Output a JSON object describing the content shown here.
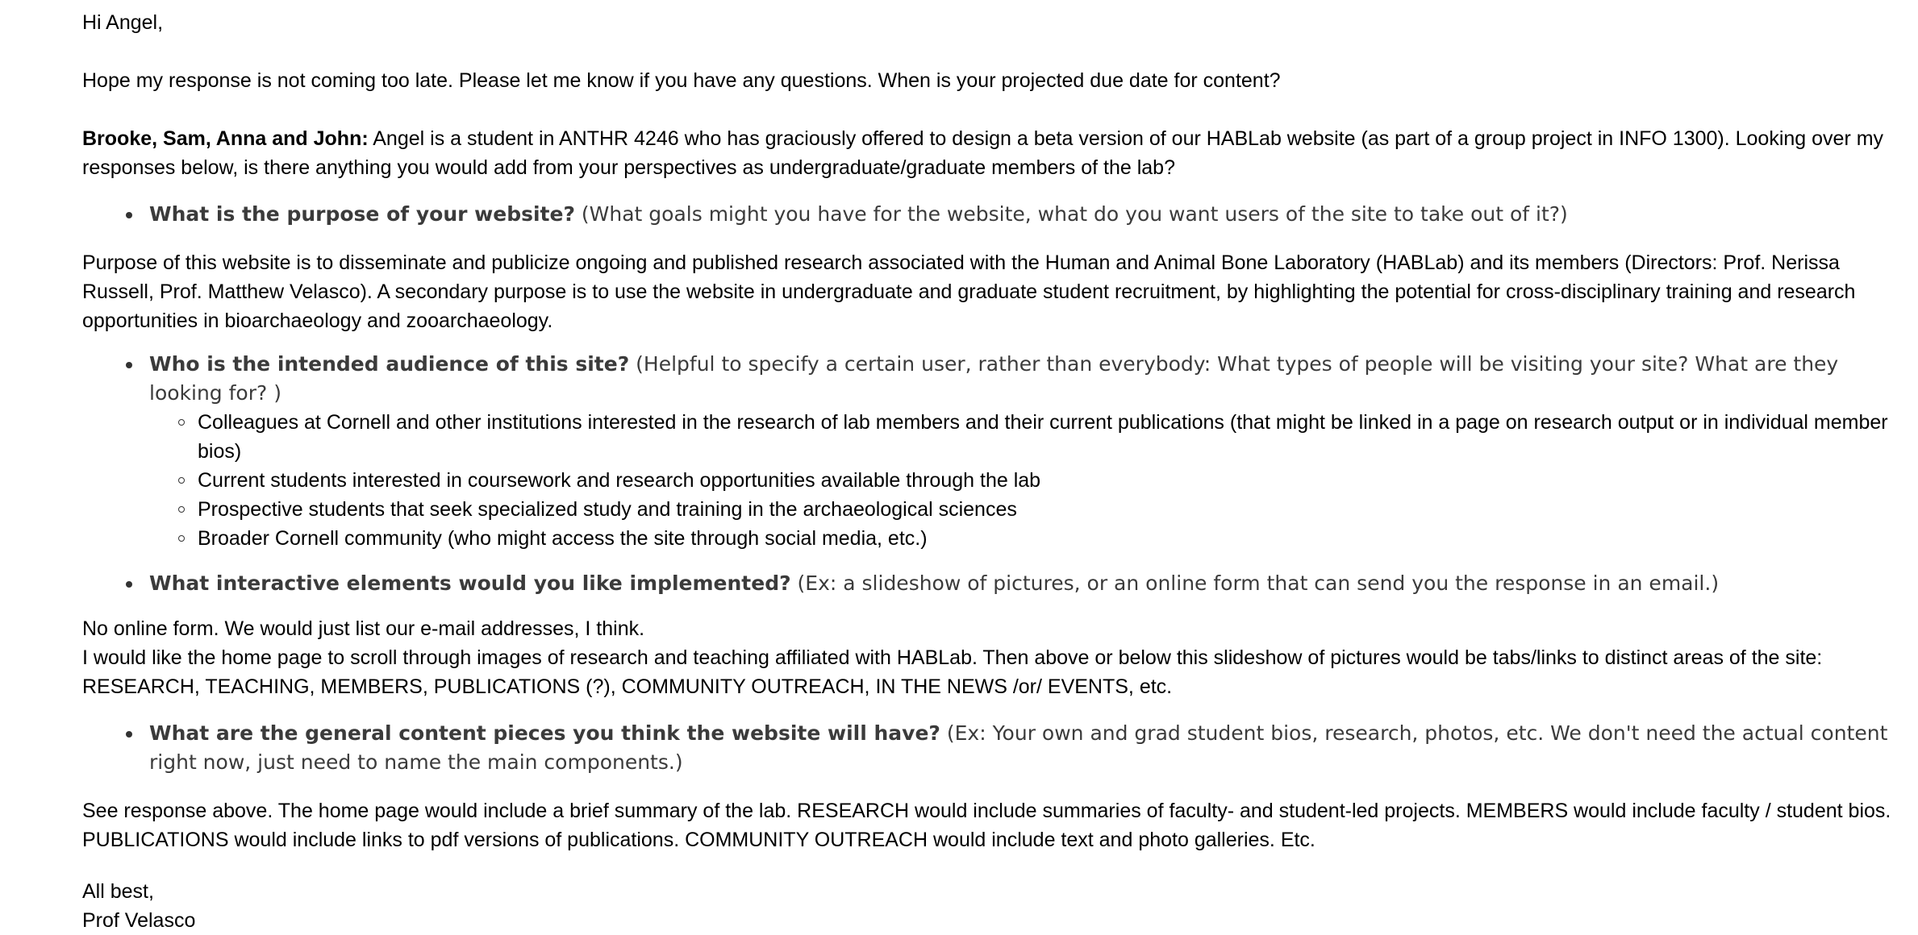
{
  "email": {
    "greeting": "Hi Angel,",
    "intro": "Hope my response is not coming too late. Please let me know if you have any questions. When is your projected due date for content?",
    "addressees": "Brooke, Sam, Anna and John:",
    "addressees_body": " Angel is a student in ANTHR 4246 who has graciously offered to design a beta version of our HABLab website (as part of a group project in INFO 1300). Looking over my responses below, is there anything you would add from your perspectives as undergraduate/graduate members of the lab?",
    "q1": {
      "question": "What is the purpose of your website?",
      "hint": " (What goals might you have for the website, what do you want users of the site to take out of it?)"
    },
    "a1": "Purpose of this website is to disseminate and publicize ongoing and published research associated with the Human and Animal Bone Laboratory (HABLab) and its members (Directors: Prof. Nerissa Russell, Prof. Matthew Velasco). A secondary purpose is to use the website in undergraduate and graduate student recruitment, by highlighting the potential for cross-disciplinary training and research opportunities in bioarchaeology and zooarchaeology.",
    "q2": {
      "question": "Who is the intended audience of this site?",
      "hint": " (Helpful to specify a certain user, rather than everybody: What types of people will be visiting your site? What are they looking for? )",
      "audiences": [
        "Colleagues at Cornell and other institutions interested in the research of lab members and their current publications (that might be linked in a page on research output or in individual member bios)",
        "Current students interested in coursework and research opportunities available through the lab",
        "Prospective students that seek specialized study and training in the archaeological sciences",
        "Broader Cornell community (who might access the site through social media, etc.)"
      ]
    },
    "q3": {
      "question": "What interactive elements would you like implemented?",
      "hint": " (Ex: a slideshow of pictures, or an online form that can send you the response in an email.)"
    },
    "a3_line1": "No online form. We would just list our e-mail addresses, I think.",
    "a3_line2": "I would like the home page to scroll through images of research and teaching affiliated with HABLab. Then above or below this slideshow of pictures would be tabs/links to distinct areas of the site: RESEARCH, TEACHING, MEMBERS, PUBLICATIONS (?), COMMUNITY OUTREACH, IN THE NEWS /or/ EVENTS, etc.",
    "q4": {
      "question": "What are the general content pieces you think the website will have?",
      "hint": " (Ex: Your own and grad student bios, research, photos, etc. We don't need the actual content right now, just need to name the main components.)"
    },
    "a4": "See response above. The home page would include a brief summary of the lab. RESEARCH would include summaries of faculty- and student-led projects. MEMBERS would include faculty / student bios. PUBLICATIONS would include links to pdf versions of publications. COMMUNITY OUTREACH would include text and photo galleries. Etc.",
    "signoff": "All best,",
    "signature": "Prof Velasco"
  }
}
